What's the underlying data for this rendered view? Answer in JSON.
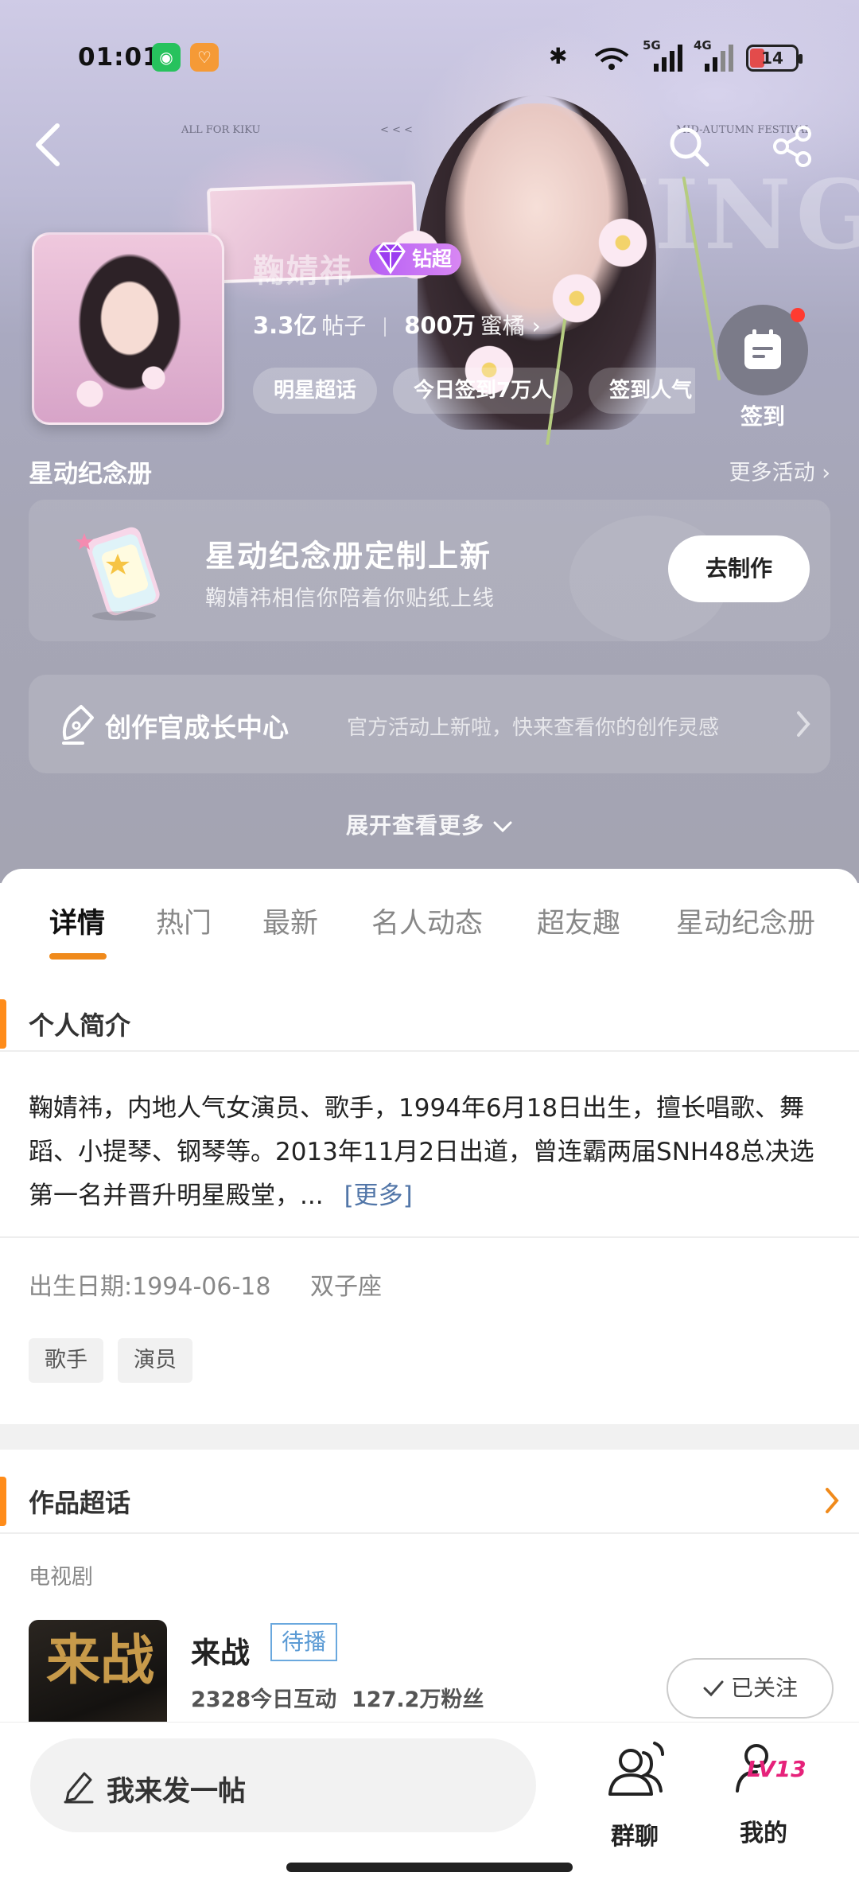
{
  "status_bar": {
    "time": "01:01",
    "battery": "14",
    "net1": "5G",
    "net2": "4G"
  },
  "hero": {
    "art_caption_left": "ALL FOR KIKU",
    "art_caption_mid": "< < <",
    "art_caption_right": "MID-AUTUMN FESTIVAL",
    "art_bigtext": "JINGYI"
  },
  "profile": {
    "name": "鞠婧祎",
    "badge_label": "钻超",
    "posts_value": "3.3亿",
    "posts_label": "帖子",
    "fans_value": "800万",
    "fans_label": "蜜橘",
    "chips": [
      "明星超话",
      "今日签到7万人",
      "签到人气"
    ],
    "signin_label": "签到"
  },
  "memorial": {
    "title": "星动纪念册",
    "more": "更多活动",
    "promo_title": "星动纪念册定制上新",
    "promo_sub": "鞠婧祎相信你陪着你贴纸上线",
    "promo_button": "去制作"
  },
  "creator": {
    "title": "创作官成长中心",
    "sub": "官方活动上新啦，快来查看你的创作灵感"
  },
  "expand_label": "展开查看更多",
  "tabs": [
    "详情",
    "热门",
    "最新",
    "名人动态",
    "超友趣",
    "星动纪念册"
  ],
  "intro": {
    "title": "个人简介",
    "bio": "鞠婧祎，内地人气女演员、歌手，1994年6月18日出生，擅长唱歌、舞蹈、小提琴、钢琴等。2013年11月2日出道，曾连霸两届SNH48总决选第一名并晋升明星殿堂，...",
    "more": "[更多]",
    "birth": "出生日期:1994-06-18",
    "zodiac": "双子座",
    "tags": [
      "歌手",
      "演员"
    ]
  },
  "works": {
    "title": "作品超话",
    "category": "电视剧",
    "item": {
      "poster_text": "来战",
      "name": "来战",
      "status": "待播",
      "interactions": "2328今日互动",
      "fans": "127.2万粉丝",
      "follow_label": "已关注"
    }
  },
  "bottom_bar": {
    "compose_placeholder": "我来发一帖",
    "group_chat": "群聊",
    "mine": "我的",
    "level": "LV13"
  },
  "colors": {
    "accent": "#ff8c1a",
    "badge": "#b65ff4",
    "link": "#5276a8",
    "level": "#e6227a"
  }
}
